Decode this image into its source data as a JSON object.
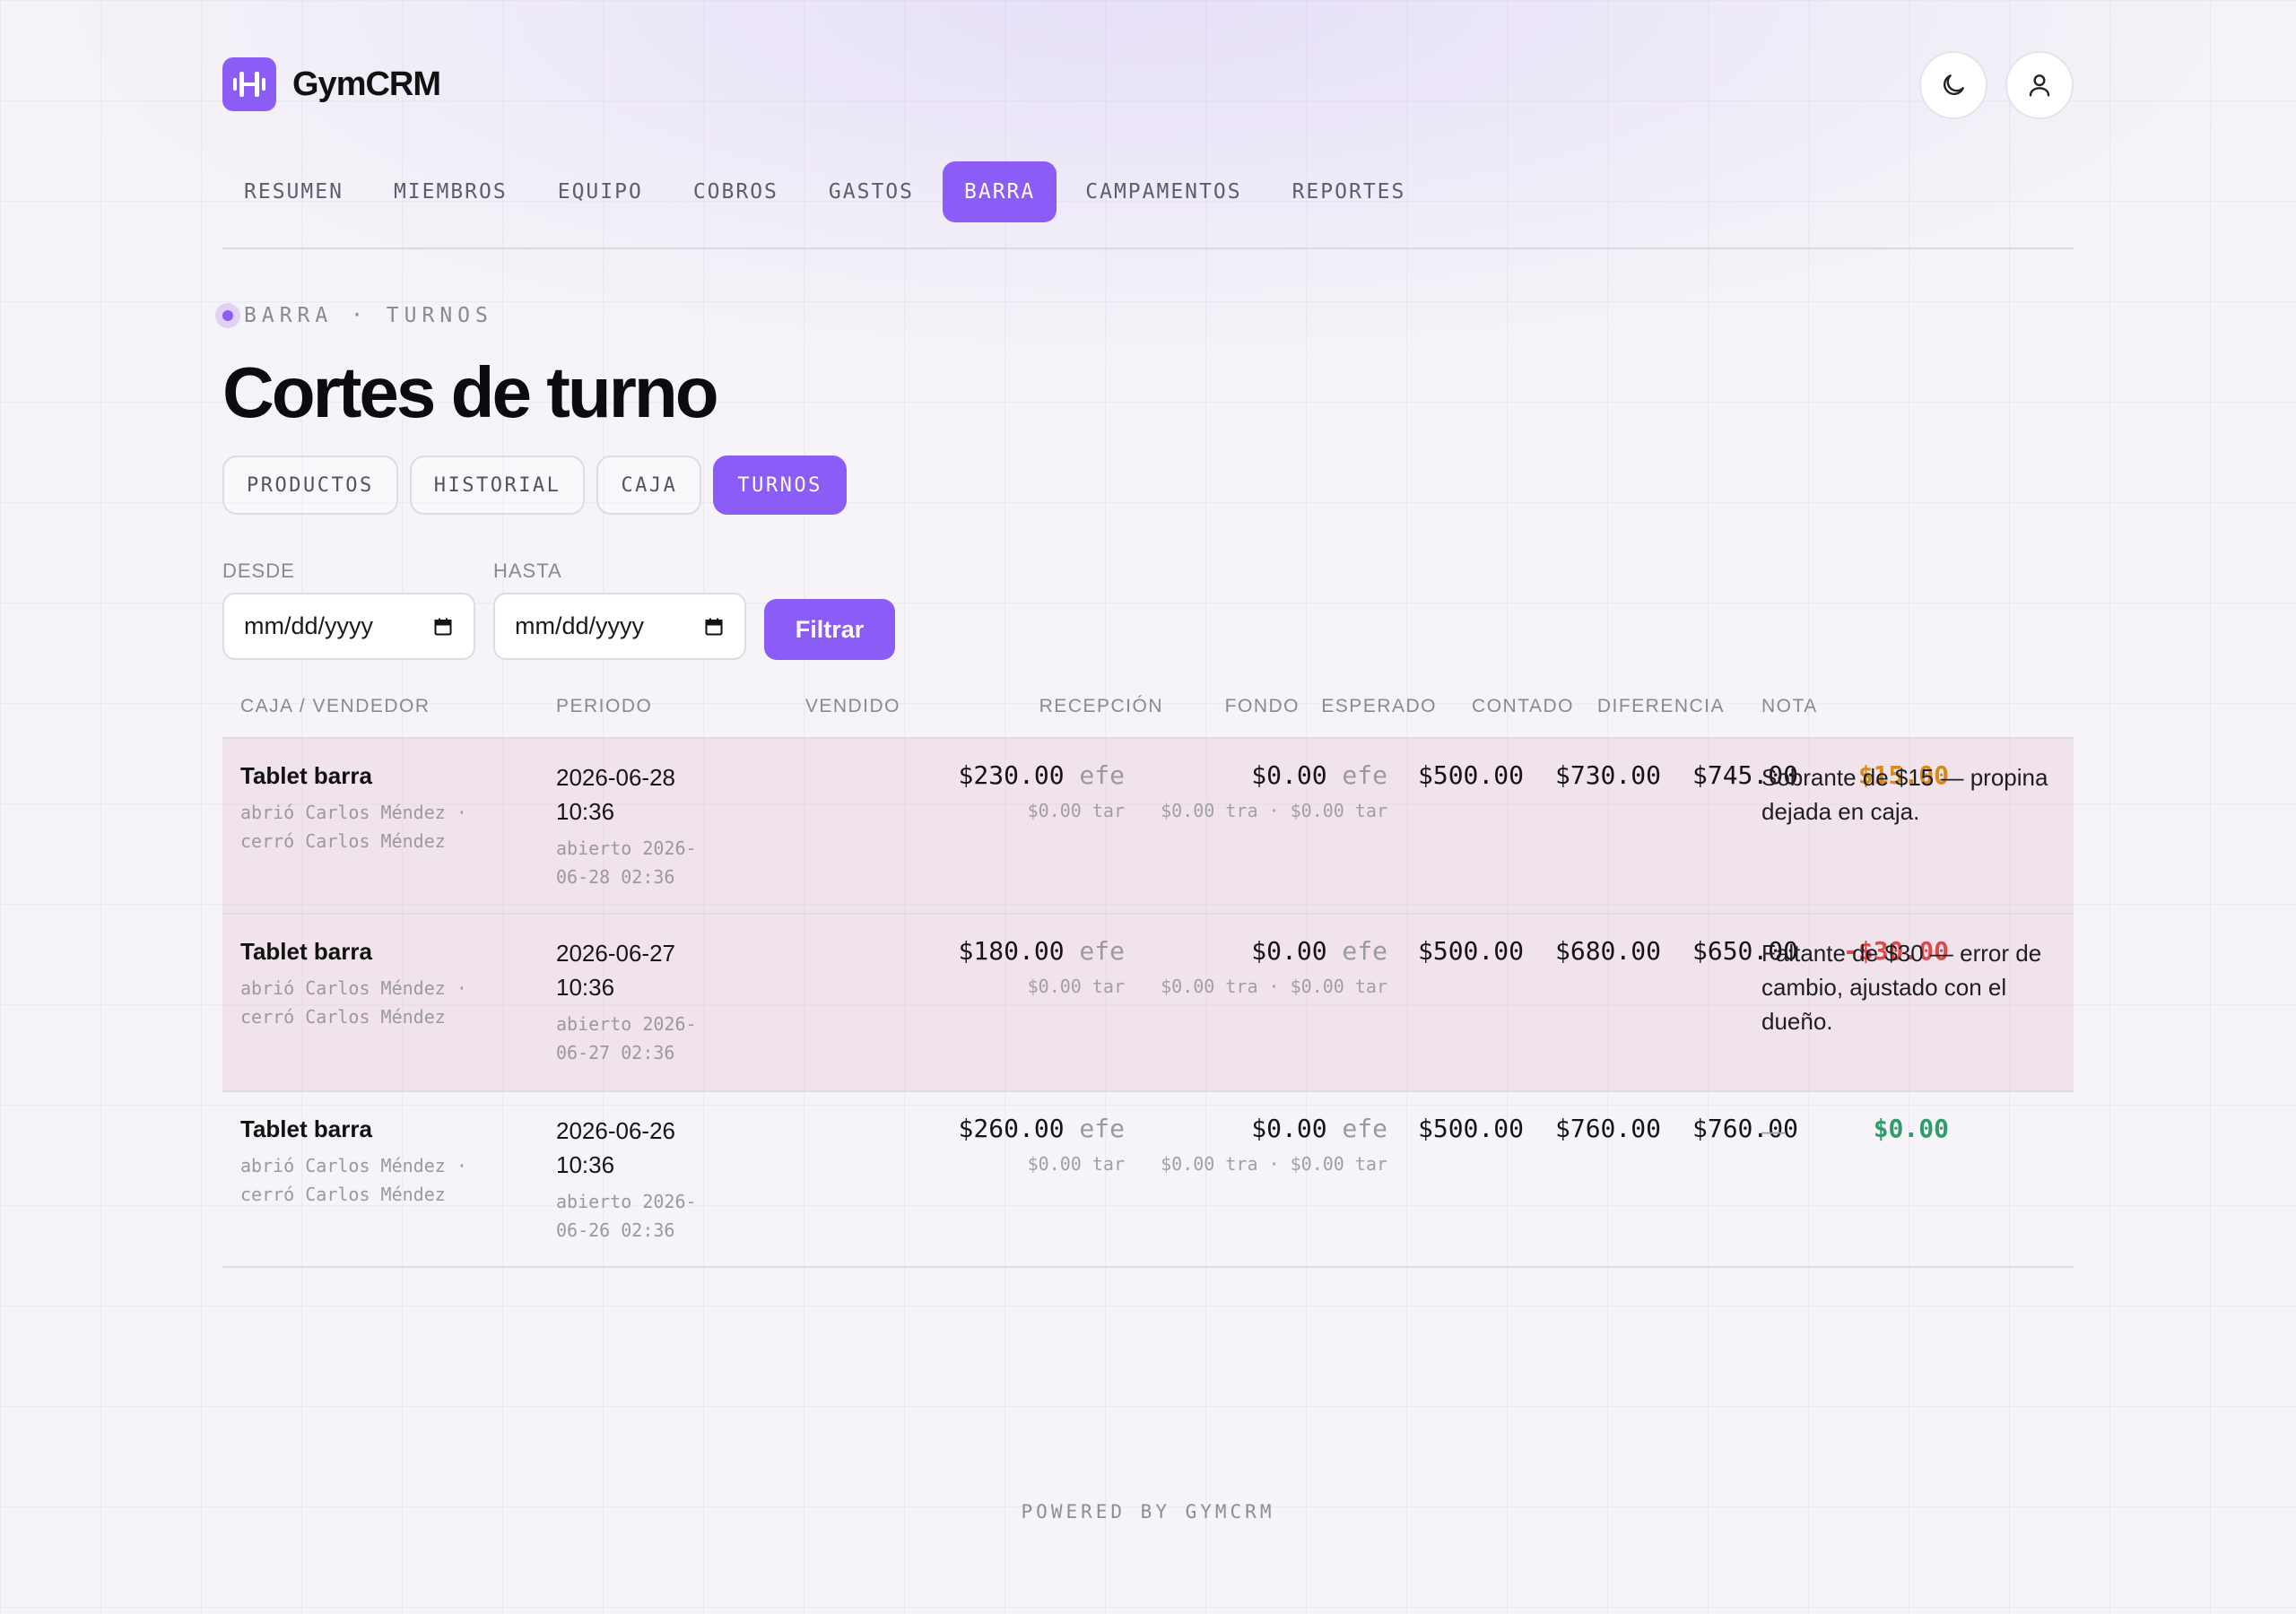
{
  "app": {
    "name": "GymCRM"
  },
  "header": {
    "theme_icon": "moon-icon",
    "user_icon": "user-icon"
  },
  "nav": {
    "items": [
      {
        "label": "RESUMEN"
      },
      {
        "label": "MIEMBROS"
      },
      {
        "label": "EQUIPO"
      },
      {
        "label": "COBROS"
      },
      {
        "label": "GASTOS"
      },
      {
        "label": "BARRA",
        "active": true
      },
      {
        "label": "CAMPAMENTOS"
      },
      {
        "label": "REPORTES"
      }
    ]
  },
  "breadcrumb": "BARRA · TURNOS",
  "page_title": "Cortes de turno",
  "subtabs": [
    {
      "label": "PRODUCTOS"
    },
    {
      "label": "HISTORIAL"
    },
    {
      "label": "CAJA"
    },
    {
      "label": "TURNOS",
      "active": true
    }
  ],
  "filters": {
    "desde_label": "DESDE",
    "desde_value": "mm/dd/yyyy",
    "hasta_label": "HASTA",
    "hasta_value": "mm/dd/yyyy",
    "button_label": "Filtrar"
  },
  "table": {
    "headers": [
      "CAJA / VENDEDOR",
      "PERIODO",
      "VENDIDO",
      "RECEPCIÓN",
      "FONDO",
      "ESPERADO",
      "CONTADO",
      "DIFERENCIA",
      "NOTA"
    ],
    "rows": [
      {
        "caja": "Tablet barra",
        "abrio": "abrió Carlos Méndez ·",
        "cerro": "cerró Carlos Méndez",
        "periodo_1": "2026-06-28",
        "periodo_2": "10:36",
        "abierto_1": "abierto 2026-",
        "abierto_2": "06-28 02:36",
        "vendido": "$230.00",
        "vendido_unit": "efe",
        "vendido_sub": "$0.00 tar",
        "recepcion": "$0.00",
        "recepcion_unit": "efe",
        "recepcion_sub": "$0.00 tra · $0.00 tar",
        "fondo": "$500.00",
        "esperado": "$730.00",
        "contado": "$745.00",
        "diferencia": "$15.00",
        "nota": "Sobrante de $15 — propina dejada en caja."
      },
      {
        "caja": "Tablet barra",
        "abrio": "abrió Carlos Méndez ·",
        "cerro": "cerró Carlos Méndez",
        "periodo_1": "2026-06-27",
        "periodo_2": "10:36",
        "abierto_1": "abierto 2026-",
        "abierto_2": "06-27 02:36",
        "vendido": "$180.00",
        "vendido_unit": "efe",
        "vendido_sub": "$0.00 tar",
        "recepcion": "$0.00",
        "recepcion_unit": "efe",
        "recepcion_sub": "$0.00 tra · $0.00 tar",
        "fondo": "$500.00",
        "esperado": "$680.00",
        "contado": "$650.00",
        "diferencia": "-$30.00",
        "nota": "Faltante de $30 — error de cambio, ajustado con el dueño."
      },
      {
        "caja": "Tablet barra",
        "abrio": "abrió Carlos Méndez ·",
        "cerro": "cerró Carlos Méndez",
        "periodo_1": "2026-06-26",
        "periodo_2": "10:36",
        "abierto_1": "abierto 2026-",
        "abierto_2": "06-26 02:36",
        "vendido": "$260.00",
        "vendido_unit": "efe",
        "vendido_sub": "$0.00 tar",
        "recepcion": "$0.00",
        "recepcion_unit": "efe",
        "recepcion_sub": "$0.00 tra · $0.00 tar",
        "fondo": "$500.00",
        "esperado": "$760.00",
        "contado": "$760.00",
        "diferencia": "$0.00",
        "nota": "—"
      }
    ]
  },
  "colors": {
    "accent": "#8b5cf6",
    "positive": "#2e9d6a",
    "negative": "#dc4a4a",
    "warning": "#d98a16"
  },
  "footer": "POWERED BY GYMCRM"
}
